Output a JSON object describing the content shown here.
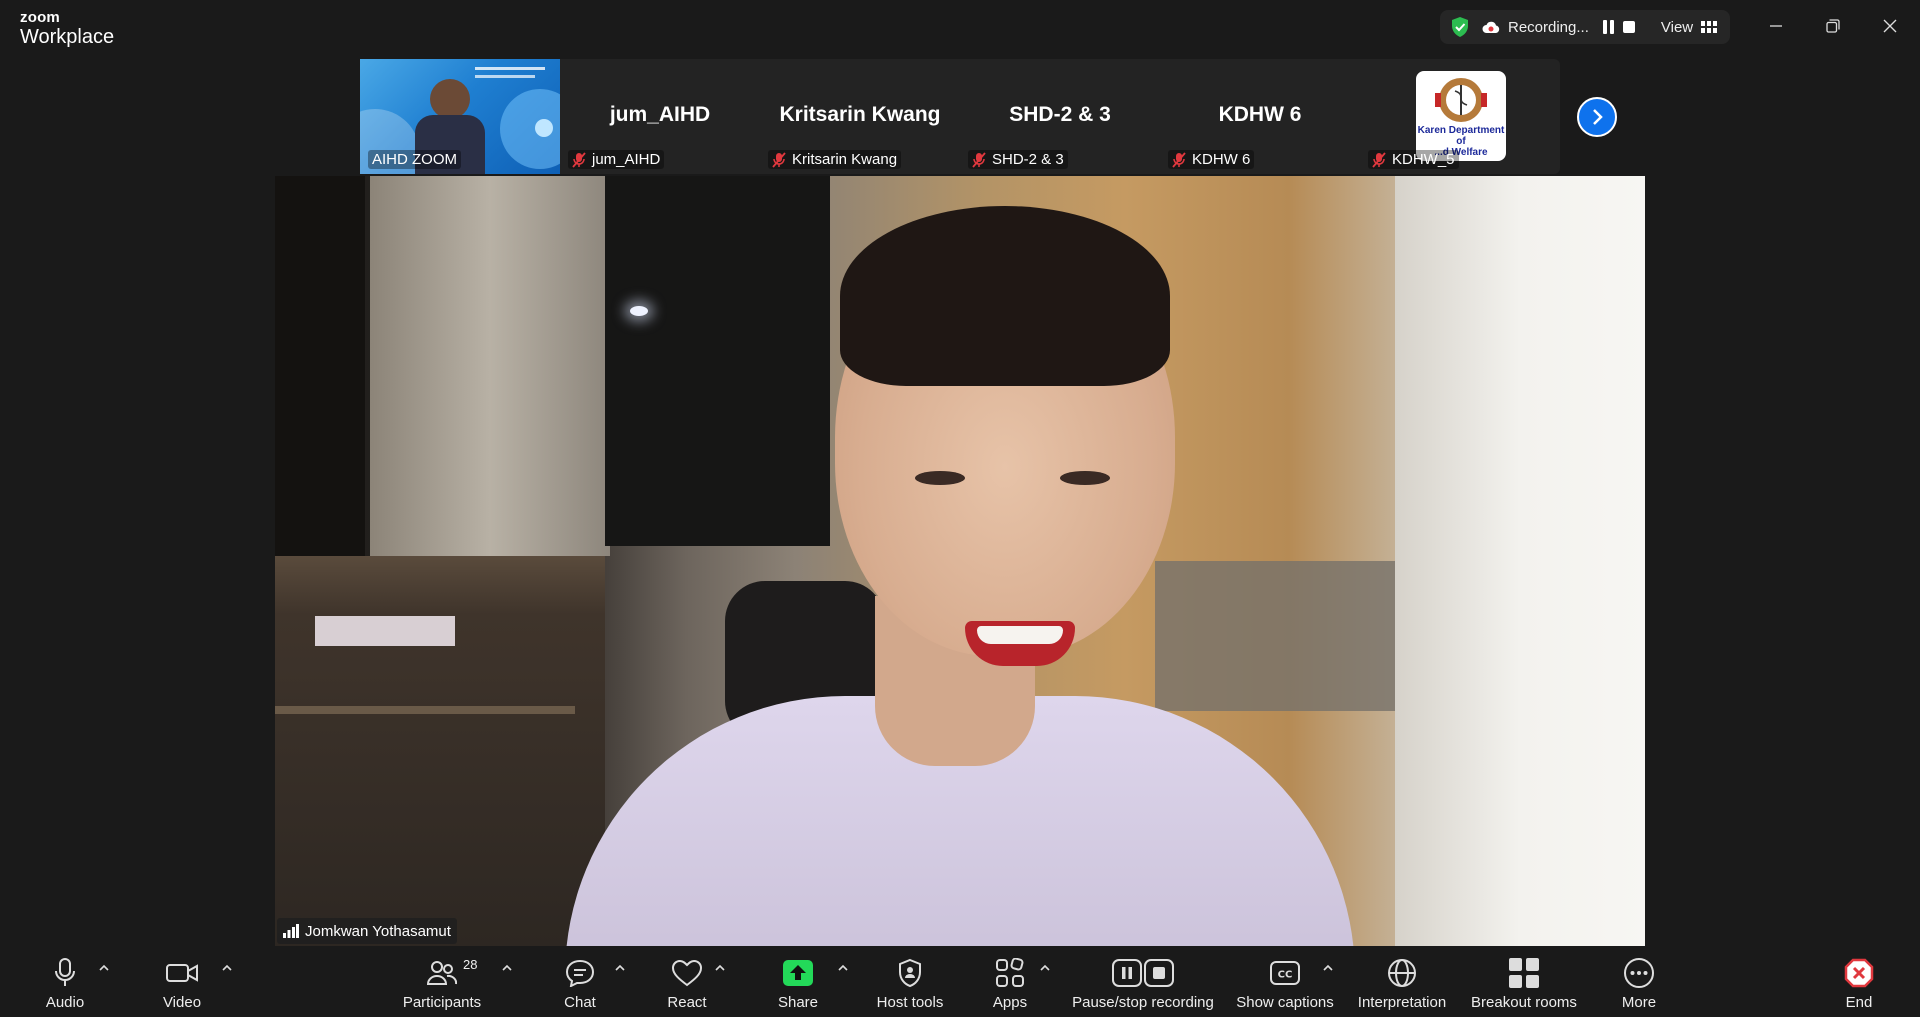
{
  "app": {
    "brand_top": "zoom",
    "brand_bottom": "Workplace"
  },
  "titlebar": {
    "recording_text": "Recording...",
    "view_label": "View"
  },
  "thumbnails": [
    {
      "name_center": "",
      "label": "AIHD ZOOM",
      "muted": false
    },
    {
      "name_center": "jum_AIHD",
      "label": "jum_AIHD",
      "muted": true
    },
    {
      "name_center": "Kritsarin Kwang",
      "label": "Kritsarin Kwang",
      "muted": true
    },
    {
      "name_center": "SHD-2 & 3",
      "label": "SHD-2 & 3",
      "muted": true
    },
    {
      "name_center": "KDHW 6",
      "label": "KDHW 6",
      "muted": true
    },
    {
      "name_center": "",
      "label": "KDHW_5",
      "muted": true
    }
  ],
  "logo_text": {
    "line1": "Karen Department of",
    "line2": "...d Welfare"
  },
  "main_video": {
    "speaker_name": "Jomkwan Yothasamut"
  },
  "toolbar": {
    "audio": "Audio",
    "video": "Video",
    "participants": "Participants",
    "participants_count": "28",
    "chat": "Chat",
    "react": "React",
    "share": "Share",
    "host_tools": "Host tools",
    "apps": "Apps",
    "pause_stop_recording": "Pause/stop recording",
    "show_captions": "Show captions",
    "interpretation": "Interpretation",
    "breakout_rooms": "Breakout rooms",
    "more": "More",
    "end": "End"
  },
  "colors": {
    "accent_blue": "#0e72ed",
    "share_green": "#23d959",
    "muted_red": "#e0383e",
    "end_red": "#e0383e",
    "shield_green": "#2cbc50"
  }
}
